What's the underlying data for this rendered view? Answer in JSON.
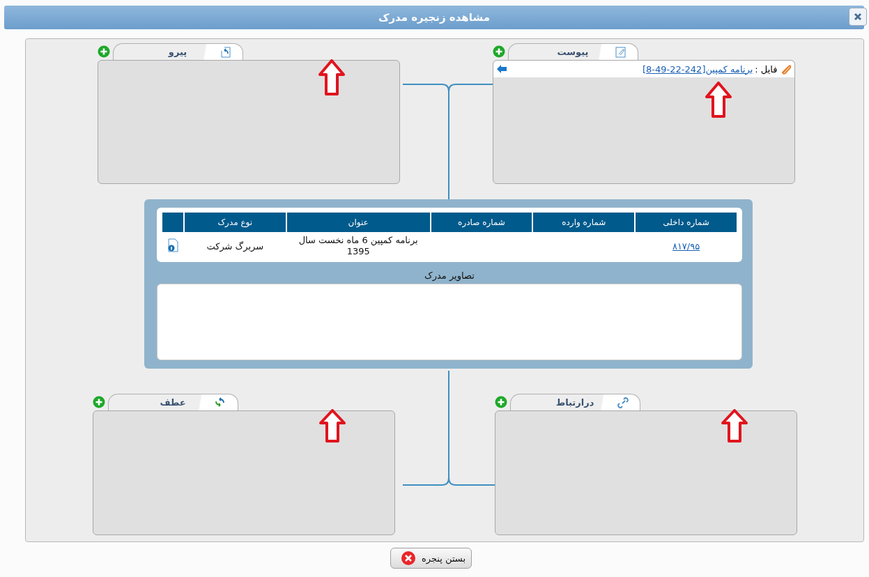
{
  "window": {
    "title": "مشاهده زنجیره مدرک"
  },
  "top_panels": [
    {
      "kind": "attachment",
      "title": "پیوست",
      "annotated": true,
      "files": [
        {
          "label": "فایل :",
          "link": "برنامه کمپین[242-22-49-8]"
        }
      ]
    },
    {
      "kind": "reference",
      "title": "پیرو",
      "annotated": true
    }
  ],
  "bottom_panels": [
    {
      "kind": "related",
      "title": "درارتباط",
      "annotated": true
    },
    {
      "kind": "precedent",
      "title": "عطف",
      "annotated": true
    }
  ],
  "document": {
    "columns": [
      "شماره داخلی",
      "شماره وارده",
      "شماره صادره",
      "عنوان",
      "نوع مدرک"
    ],
    "rows": [
      {
        "internal_number": "۸۱۷/۹۵",
        "title": "برنامه کمپین 6 ماه نخست سال 1395",
        "doc_type": "سربرگ شرکت"
      }
    ],
    "images_label": "تصاویر مدرک"
  },
  "close_button": "بستن پنجره"
}
